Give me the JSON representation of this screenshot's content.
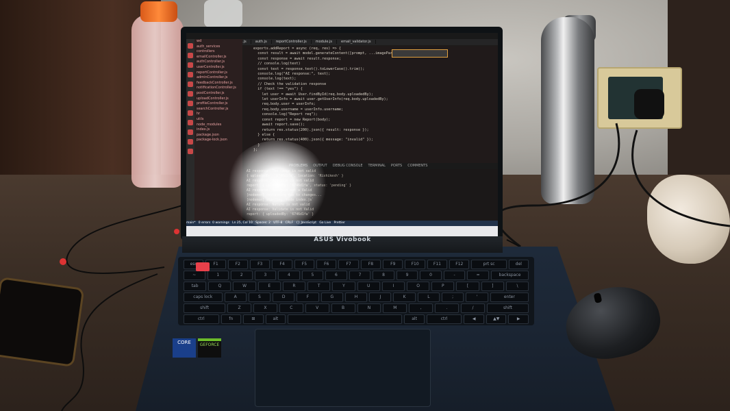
{
  "laptop": {
    "brand_label": "ASUS Vivobook",
    "stickers": {
      "intel": "CORE",
      "nvidia": "GEFORCE"
    },
    "ide": {
      "title": "",
      "tabs": [
        "user_ncntc_controllers.js",
        "auth.js",
        "reportController.js",
        "module.js",
        "email_validator.js"
      ],
      "explorer_items": [
        "wd",
        "auth_services",
        "controllers",
        "emailController.js",
        "authController.js",
        "userController.js",
        "reportController.js",
        "adminController.js",
        "feedbackController.js",
        "notificationController.js",
        "postController.js",
        "uploadController.js",
        "profileController.js",
        "searchController.js",
        "hr",
        "utils",
        "node_modules",
        "index.js",
        "package.json",
        "package-lock.json"
      ],
      "code_lines": [
        "exports.addReport = async (req, res) => {",
        "  const result = await model.generateContent([prompt, ...imageParts]);",
        "  const response = await result.response;",
        "  // console.log(text)",
        "",
        "  const text = response.text().toLowerCase().trim();",
        "  console.log(\"AI response:\", text);",
        "  console.log(text);",
        "",
        "  // Check the validation response",
        "  if (text !== \"yes\") {",
        "    let user = await User.findById(req.body.uploadedBy);",
        "    let userInfo = await user.getUserInfo(req.body.uploadedBy);",
        "    req.body.user = userInfo;",
        "    req.body.username = userInfo.username;",
        "    console.log(\"Report req\");",
        "    const report = new Report(body);",
        "    await report.save();",
        "    return res.status(200).json({ result: response });",
        "  } else {",
        "    return res.status(400).json({ message: \"invalid\" });",
        "  }",
        "};"
      ],
      "panel_tabs": [
        "PROBLEMS",
        "OUTPUT",
        "DEBUG CONSOLE",
        "TERMINAL",
        "PORTS",
        "COMMENTS"
      ],
      "terminal_lines": [
        "AI response: The image is not valid",
        "{ uploadedBy: '6746d1fa', location: 'Rishikesh' }",
        "AI response: Analysis is not valid",
        "report: { uploadedBy: '6746d1fa', status: 'pending' }",
        "AI response: Analysis not a Valid",
        "[nodemon] restarting due to changes...",
        "[nodemon] starting `node index.js`",
        "AI response: Nature is not valid",
        "AI response: Validate is not Valid",
        "report: { uploadedBy: '6746d1fa' }"
      ],
      "status_text": "main*   0 errors  0 warnings   Ln 25, Col 10   Spaces: 2   UTF-8   CRLF   {} JavaScript   Go Live   Prettier"
    },
    "keyboard_rows": [
      [
        "esc",
        "F1",
        "F2",
        "F3",
        "F4",
        "F5",
        "F6",
        "F7",
        "F8",
        "F9",
        "F10",
        "F11",
        "F12",
        "prt sc",
        "del"
      ],
      [
        "~",
        "1",
        "2",
        "3",
        "4",
        "5",
        "6",
        "7",
        "8",
        "9",
        "0",
        "-",
        "=",
        "backspace"
      ],
      [
        "tab",
        "Q",
        "W",
        "E",
        "R",
        "T",
        "Y",
        "U",
        "I",
        "O",
        "P",
        "[",
        "]",
        "\\"
      ],
      [
        "caps lock",
        "A",
        "S",
        "D",
        "F",
        "G",
        "H",
        "J",
        "K",
        "L",
        ";",
        "'",
        "enter"
      ],
      [
        "shift",
        "Z",
        "X",
        "C",
        "V",
        "B",
        "N",
        "M",
        ",",
        ".",
        "/",
        "shift"
      ],
      [
        "ctrl",
        "fn",
        "⊞",
        "alt",
        "",
        "alt",
        "ctrl",
        "◀",
        "▲▼",
        "▶"
      ]
    ]
  },
  "colors": {
    "accent_red": "#e8404a",
    "intel_blue": "#1a3f8a",
    "nvidia_green": "#6cbb2a"
  },
  "icons": [
    "power-key",
    "windows-key",
    "plug",
    "mouse"
  ]
}
